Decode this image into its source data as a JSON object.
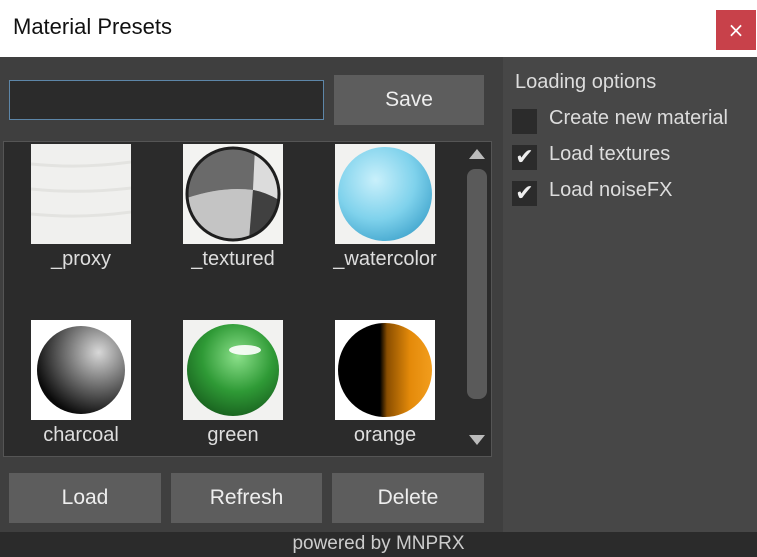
{
  "window": {
    "title": "Material Presets",
    "close_label": "×"
  },
  "name_input": {
    "value": "",
    "placeholder": ""
  },
  "toolbar": {
    "save_label": "Save"
  },
  "presets": [
    {
      "name": "_proxy",
      "icon": "paper-swatch"
    },
    {
      "name": "_textured",
      "icon": "gray-quadrant-sphere"
    },
    {
      "name": "_watercolor",
      "icon": "blue-watercolor-sphere"
    },
    {
      "name": "charcoal",
      "icon": "charcoal-sphere"
    },
    {
      "name": "green",
      "icon": "green-glossy-sphere"
    },
    {
      "name": "orange",
      "icon": "black-orange-split-sphere"
    }
  ],
  "actions": {
    "load_label": "Load",
    "refresh_label": "Refresh",
    "delete_label": "Delete"
  },
  "loading_options": {
    "title": "Loading options",
    "options": [
      {
        "label": "Create new material",
        "checked": false
      },
      {
        "label": "Load textures",
        "checked": true
      },
      {
        "label": "Load noiseFX",
        "checked": true
      }
    ]
  },
  "footer": {
    "text": "powered by MNPRX"
  },
  "colors": {
    "background": "#444444",
    "panel": "#3f3f3f",
    "button": "#5d5d5d",
    "close": "#c8414a",
    "input_border": "#5d86a8"
  }
}
